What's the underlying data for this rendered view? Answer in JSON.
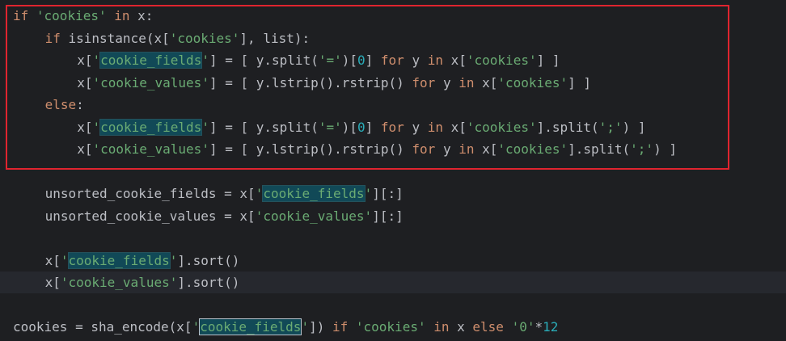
{
  "editor": {
    "highlight_box_color": "#e0242f",
    "colors": {
      "keyword": "#cf8e6d",
      "string": "#6aab73",
      "number": "#2aacb8",
      "default": "#bcbec4",
      "match_background": "#114957",
      "background": "#1e1f22"
    },
    "lines": [
      {
        "indent": 0,
        "current": false,
        "tokens": [
          {
            "t": "if",
            "k": "keyword"
          },
          {
            "t": " ",
            "k": "ident"
          },
          {
            "t": "'cookies'",
            "k": "string"
          },
          {
            "t": " ",
            "k": "ident"
          },
          {
            "t": "in",
            "k": "keyword"
          },
          {
            "t": " x:",
            "k": "ident"
          }
        ]
      },
      {
        "indent": 4,
        "current": false,
        "tokens": [
          {
            "t": "if",
            "k": "keyword"
          },
          {
            "t": " isinstance(x[",
            "k": "ident"
          },
          {
            "t": "'cookies'",
            "k": "string"
          },
          {
            "t": "], list):",
            "k": "ident"
          }
        ]
      },
      {
        "indent": 8,
        "current": false,
        "tokens": [
          {
            "t": "x[",
            "k": "ident"
          },
          {
            "t": "'",
            "k": "string"
          },
          {
            "t": "cookie_fields",
            "k": "match"
          },
          {
            "t": "'",
            "k": "string"
          },
          {
            "t": "] = [ y.split(",
            "k": "ident"
          },
          {
            "t": "'='",
            "k": "string"
          },
          {
            "t": ")[",
            "k": "ident"
          },
          {
            "t": "0",
            "k": "number"
          },
          {
            "t": "] ",
            "k": "ident"
          },
          {
            "t": "for",
            "k": "keyword"
          },
          {
            "t": " y ",
            "k": "ident"
          },
          {
            "t": "in",
            "k": "keyword"
          },
          {
            "t": " x[",
            "k": "ident"
          },
          {
            "t": "'cookies'",
            "k": "string"
          },
          {
            "t": "] ]",
            "k": "ident"
          }
        ]
      },
      {
        "indent": 8,
        "current": false,
        "tokens": [
          {
            "t": "x[",
            "k": "ident"
          },
          {
            "t": "'cookie_values'",
            "k": "string"
          },
          {
            "t": "] = [ y.lstrip().rstrip() ",
            "k": "ident"
          },
          {
            "t": "for",
            "k": "keyword"
          },
          {
            "t": " y ",
            "k": "ident"
          },
          {
            "t": "in",
            "k": "keyword"
          },
          {
            "t": " x[",
            "k": "ident"
          },
          {
            "t": "'cookies'",
            "k": "string"
          },
          {
            "t": "] ]",
            "k": "ident"
          }
        ]
      },
      {
        "indent": 4,
        "current": false,
        "tokens": [
          {
            "t": "else",
            "k": "keyword"
          },
          {
            "t": ":",
            "k": "ident"
          }
        ]
      },
      {
        "indent": 8,
        "current": false,
        "tokens": [
          {
            "t": "x[",
            "k": "ident"
          },
          {
            "t": "'",
            "k": "string"
          },
          {
            "t": "cookie_fields",
            "k": "match"
          },
          {
            "t": "'",
            "k": "string"
          },
          {
            "t": "] = [ y.split(",
            "k": "ident"
          },
          {
            "t": "'='",
            "k": "string"
          },
          {
            "t": ")[",
            "k": "ident"
          },
          {
            "t": "0",
            "k": "number"
          },
          {
            "t": "] ",
            "k": "ident"
          },
          {
            "t": "for",
            "k": "keyword"
          },
          {
            "t": " y ",
            "k": "ident"
          },
          {
            "t": "in",
            "k": "keyword"
          },
          {
            "t": " x[",
            "k": "ident"
          },
          {
            "t": "'cookies'",
            "k": "string"
          },
          {
            "t": "].split(",
            "k": "ident"
          },
          {
            "t": "';'",
            "k": "string"
          },
          {
            "t": ") ]",
            "k": "ident"
          }
        ]
      },
      {
        "indent": 8,
        "current": false,
        "tokens": [
          {
            "t": "x[",
            "k": "ident"
          },
          {
            "t": "'cookie_values'",
            "k": "string"
          },
          {
            "t": "] = [ y.lstrip().rstrip() ",
            "k": "ident"
          },
          {
            "t": "for",
            "k": "keyword"
          },
          {
            "t": " y ",
            "k": "ident"
          },
          {
            "t": "in",
            "k": "keyword"
          },
          {
            "t": " x[",
            "k": "ident"
          },
          {
            "t": "'cookies'",
            "k": "string"
          },
          {
            "t": "].split(",
            "k": "ident"
          },
          {
            "t": "';'",
            "k": "string"
          },
          {
            "t": ") ]",
            "k": "ident"
          }
        ]
      },
      {
        "indent": 0,
        "current": false,
        "tokens": []
      },
      {
        "indent": 4,
        "current": false,
        "tokens": [
          {
            "t": "unsorted_cookie_fields = x[",
            "k": "ident"
          },
          {
            "t": "'",
            "k": "string"
          },
          {
            "t": "cookie_fields",
            "k": "match"
          },
          {
            "t": "'",
            "k": "string"
          },
          {
            "t": "][:]",
            "k": "ident"
          }
        ]
      },
      {
        "indent": 4,
        "current": false,
        "tokens": [
          {
            "t": "unsorted_cookie_values = x[",
            "k": "ident"
          },
          {
            "t": "'cookie_values'",
            "k": "string"
          },
          {
            "t": "][:]",
            "k": "ident"
          }
        ]
      },
      {
        "indent": 0,
        "current": false,
        "tokens": []
      },
      {
        "indent": 4,
        "current": false,
        "tokens": [
          {
            "t": "x[",
            "k": "ident"
          },
          {
            "t": "'",
            "k": "string"
          },
          {
            "t": "cookie_fields",
            "k": "match"
          },
          {
            "t": "'",
            "k": "string"
          },
          {
            "t": "].sort()",
            "k": "ident"
          }
        ]
      },
      {
        "indent": 4,
        "current": true,
        "tokens": [
          {
            "t": "x[",
            "k": "ident"
          },
          {
            "t": "'cookie_values'",
            "k": "string"
          },
          {
            "t": "].sort()",
            "k": "ident"
          }
        ]
      },
      {
        "indent": 0,
        "current": false,
        "tokens": []
      },
      {
        "indent": 0,
        "current": false,
        "tokens": [
          {
            "t": "cookies = sha_encode(x[",
            "k": "ident"
          },
          {
            "t": "'",
            "k": "string"
          },
          {
            "t": "cookie_fields",
            "k": "match-active"
          },
          {
            "t": "'",
            "k": "string"
          },
          {
            "t": "]) ",
            "k": "ident"
          },
          {
            "t": "if",
            "k": "keyword"
          },
          {
            "t": " ",
            "k": "ident"
          },
          {
            "t": "'cookies'",
            "k": "string"
          },
          {
            "t": " ",
            "k": "ident"
          },
          {
            "t": "in",
            "k": "keyword"
          },
          {
            "t": " x ",
            "k": "ident"
          },
          {
            "t": "else",
            "k": "keyword"
          },
          {
            "t": " ",
            "k": "ident"
          },
          {
            "t": "'0'",
            "k": "string"
          },
          {
            "t": "*",
            "k": "ident"
          },
          {
            "t": "12",
            "k": "number"
          }
        ]
      }
    ]
  }
}
